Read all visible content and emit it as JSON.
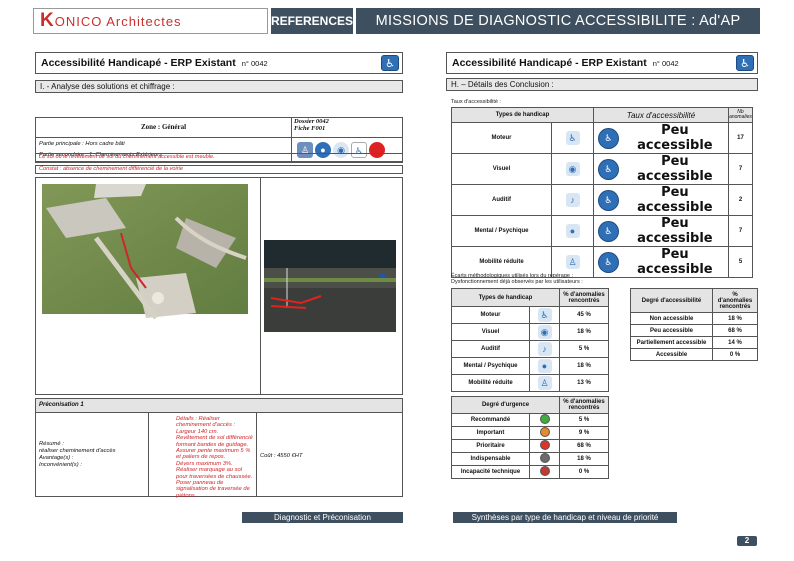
{
  "header": {
    "logo_initial": "K",
    "logo_text": "ONICO  Architectes",
    "references": "REFERENCES",
    "missions": "MISSIONS DE DIAGNOSTIC ACCESSIBILITE  : Ad'AP"
  },
  "left": {
    "title": "Accessibilité Handicapé - ERP Existant",
    "number": "n° 0042",
    "section": "I. - Analyse des solutions et chiffrage :",
    "zone_label": "Zone : Général",
    "dossier": "Dossier 0042",
    "fiche": "Fiche F001",
    "partie_principale": "Partie principale : Hors cadre bâti",
    "partie_secondaire": "Partie secondaire : 1. Cheminements Extérieurs",
    "observation": "Le sol ou le revêtement de sol du cheminement accessible est meuble.",
    "constat": "Constat : absence de cheminement différencié de la voirie",
    "preco_title": "Préconisation 1",
    "resume": "Résumé :",
    "resume_text": "réaliser cheminement d'accès",
    "avantages": "Avantage(s) :",
    "inconvenients": "Inconvénient(s) :",
    "detail": "Détails : Réaliser cheminement d'accès :\nLargeur 140 cm.\nRevêtement de sol différencié formant bandes de guidage.\nAssurer pente maximum 5 % et paliers de repos.\nDévers maximum 3%.\nRéaliser marquage au sol pour traversées de chaussée.\nPoser panneau de signalisation de traversée de piétons",
    "cout": "Coût : 4550 €HT",
    "footer": "Diagnostic et Préconisation"
  },
  "right": {
    "title": "Accessibilité Handicapé - ERP Existant",
    "number": "n° 0042",
    "section": "H. – Détails des Conclusion :",
    "taux_label": "Taux d'accessibilité :",
    "t1_headers": [
      "Types de handicap",
      "Taux d'accessibilité",
      "Nb",
      "anomalies"
    ],
    "t1_rows": [
      {
        "type": "Moteur",
        "icon": "wheelchair-icon",
        "glyph": "♿",
        "status": "Peu accessible",
        "nb": "17"
      },
      {
        "type": "Visuel",
        "icon": "eye-icon",
        "glyph": "◉",
        "status": "Peu accessible",
        "nb": "7"
      },
      {
        "type": "Auditif",
        "icon": "ear-icon",
        "glyph": "♪",
        "status": "Peu accessible",
        "nb": "2"
      },
      {
        "type": "Mental / Psychique",
        "icon": "head-icon",
        "glyph": "●",
        "status": "Peu accessible",
        "nb": "7"
      },
      {
        "type": "Mobilité réduite",
        "icon": "walking-person-icon",
        "glyph": "♙",
        "status": "Peu accessible",
        "nb": "5"
      }
    ],
    "ecarts_1": "Écarts méthodologiques utilisés lors du repérage :",
    "ecarts_2": "Dysfonctionnement déjà observés par les utilisateurs :",
    "t2_headers": [
      "Types de handicap",
      "% d'anomalies rencontrés"
    ],
    "t2_rows": [
      {
        "type": "Moteur",
        "glyph": "♿",
        "icon": "wheelchair-icon",
        "pct": "45 %"
      },
      {
        "type": "Visuel",
        "glyph": "◉",
        "icon": "eye-icon",
        "pct": "18 %"
      },
      {
        "type": "Auditif",
        "glyph": "♪",
        "icon": "ear-icon",
        "pct": "5 %"
      },
      {
        "type": "Mental / Psychique",
        "glyph": "●",
        "icon": "head-icon",
        "pct": "18 %"
      },
      {
        "type": "Mobilité réduite",
        "glyph": "♙",
        "icon": "walking-person-icon",
        "pct": "13 %"
      }
    ],
    "t3_headers": [
      "Degré d'accessibilité",
      "%",
      "d'anomalies",
      "rencontrés"
    ],
    "t3_rows": [
      {
        "label": "Non accessible",
        "pct": "18 %"
      },
      {
        "label": "Peu accessible",
        "pct": "68 %"
      },
      {
        "label": "Partiellement accessible",
        "pct": "14 %"
      },
      {
        "label": "Accessible",
        "pct": "0 %"
      }
    ],
    "t4_headers": [
      "Degré d'urgence",
      "% d'anomalies rencontrés"
    ],
    "t4_rows": [
      {
        "label": "Recommandé",
        "color": "#3fae3f",
        "pct": "5 %"
      },
      {
        "label": "Important",
        "color": "#e38a2a",
        "pct": "9 %"
      },
      {
        "label": "Prioritaire",
        "color": "#d9352b",
        "pct": "68 %"
      },
      {
        "label": "Indispensable",
        "color": "#6b6b6b",
        "pct": "18 %"
      },
      {
        "label": "Incapacité technique",
        "color": "#c23b32",
        "pct": "0 %"
      }
    ],
    "footer": "Synthèses par type de handicap et niveau de priorité"
  },
  "page_number": "2",
  "colors": {
    "bar": "#3e5060",
    "accent_red": "#d0262a",
    "icon_blue": "#2f6fb6"
  }
}
